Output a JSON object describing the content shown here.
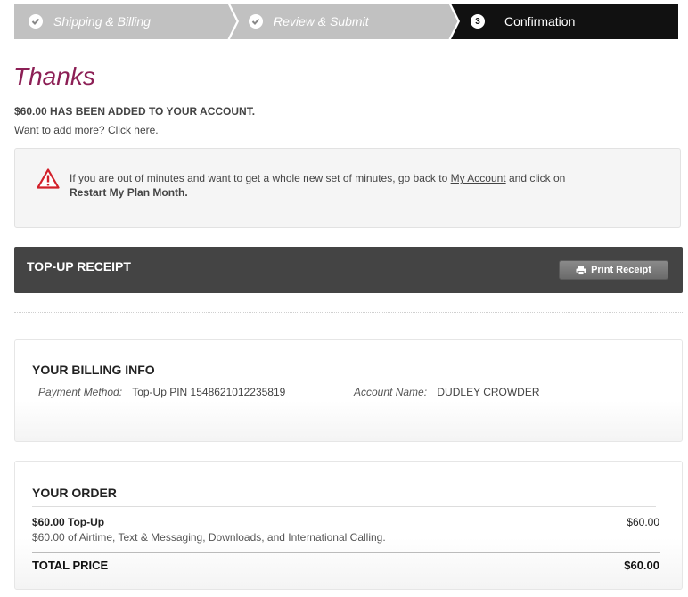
{
  "steps": [
    {
      "label": "Shipping & Billing",
      "state": "done"
    },
    {
      "label": "Review & Submit",
      "state": "done"
    },
    {
      "label": "Confirmation",
      "number": "3",
      "state": "current"
    }
  ],
  "colors": {
    "step_done": "#c1c1c1",
    "step_current": "#111111",
    "thanks": "#8c1f55",
    "alert_icon": "#d2202a"
  },
  "thanks": {
    "heading": "Thanks",
    "added_text": "$60.00 HAS BEEN ADDED TO YOUR ACCOUNT.",
    "more_prefix": "Want to add more?",
    "more_link": "Click here."
  },
  "alert": {
    "icon": "warning-triangle-icon",
    "text_before": "If you are out of minutes and want to get a whole new set of minutes, go back to",
    "link": "My Account",
    "text_middle": "and click on",
    "bold": "Restart My Plan Month."
  },
  "receipt": {
    "title": "TOP-UP RECEIPT",
    "print_label": "Print Receipt",
    "print_icon": "printer-icon"
  },
  "billing": {
    "heading": "YOUR BILLING INFO",
    "payment_label": "Payment Method:",
    "payment_value": "Top-Up PIN 1548621012235819",
    "account_label": "Account Name:",
    "account_value": "DUDLEY CROWDER"
  },
  "order": {
    "heading": "YOUR ORDER",
    "item_name": "$60.00 Top-Up",
    "item_desc": "$60.00 of Airtime, Text & Messaging, Downloads, and International Calling.",
    "item_price": "$60.00",
    "total_label": "TOTAL PRICE",
    "total_value": "$60.00"
  }
}
